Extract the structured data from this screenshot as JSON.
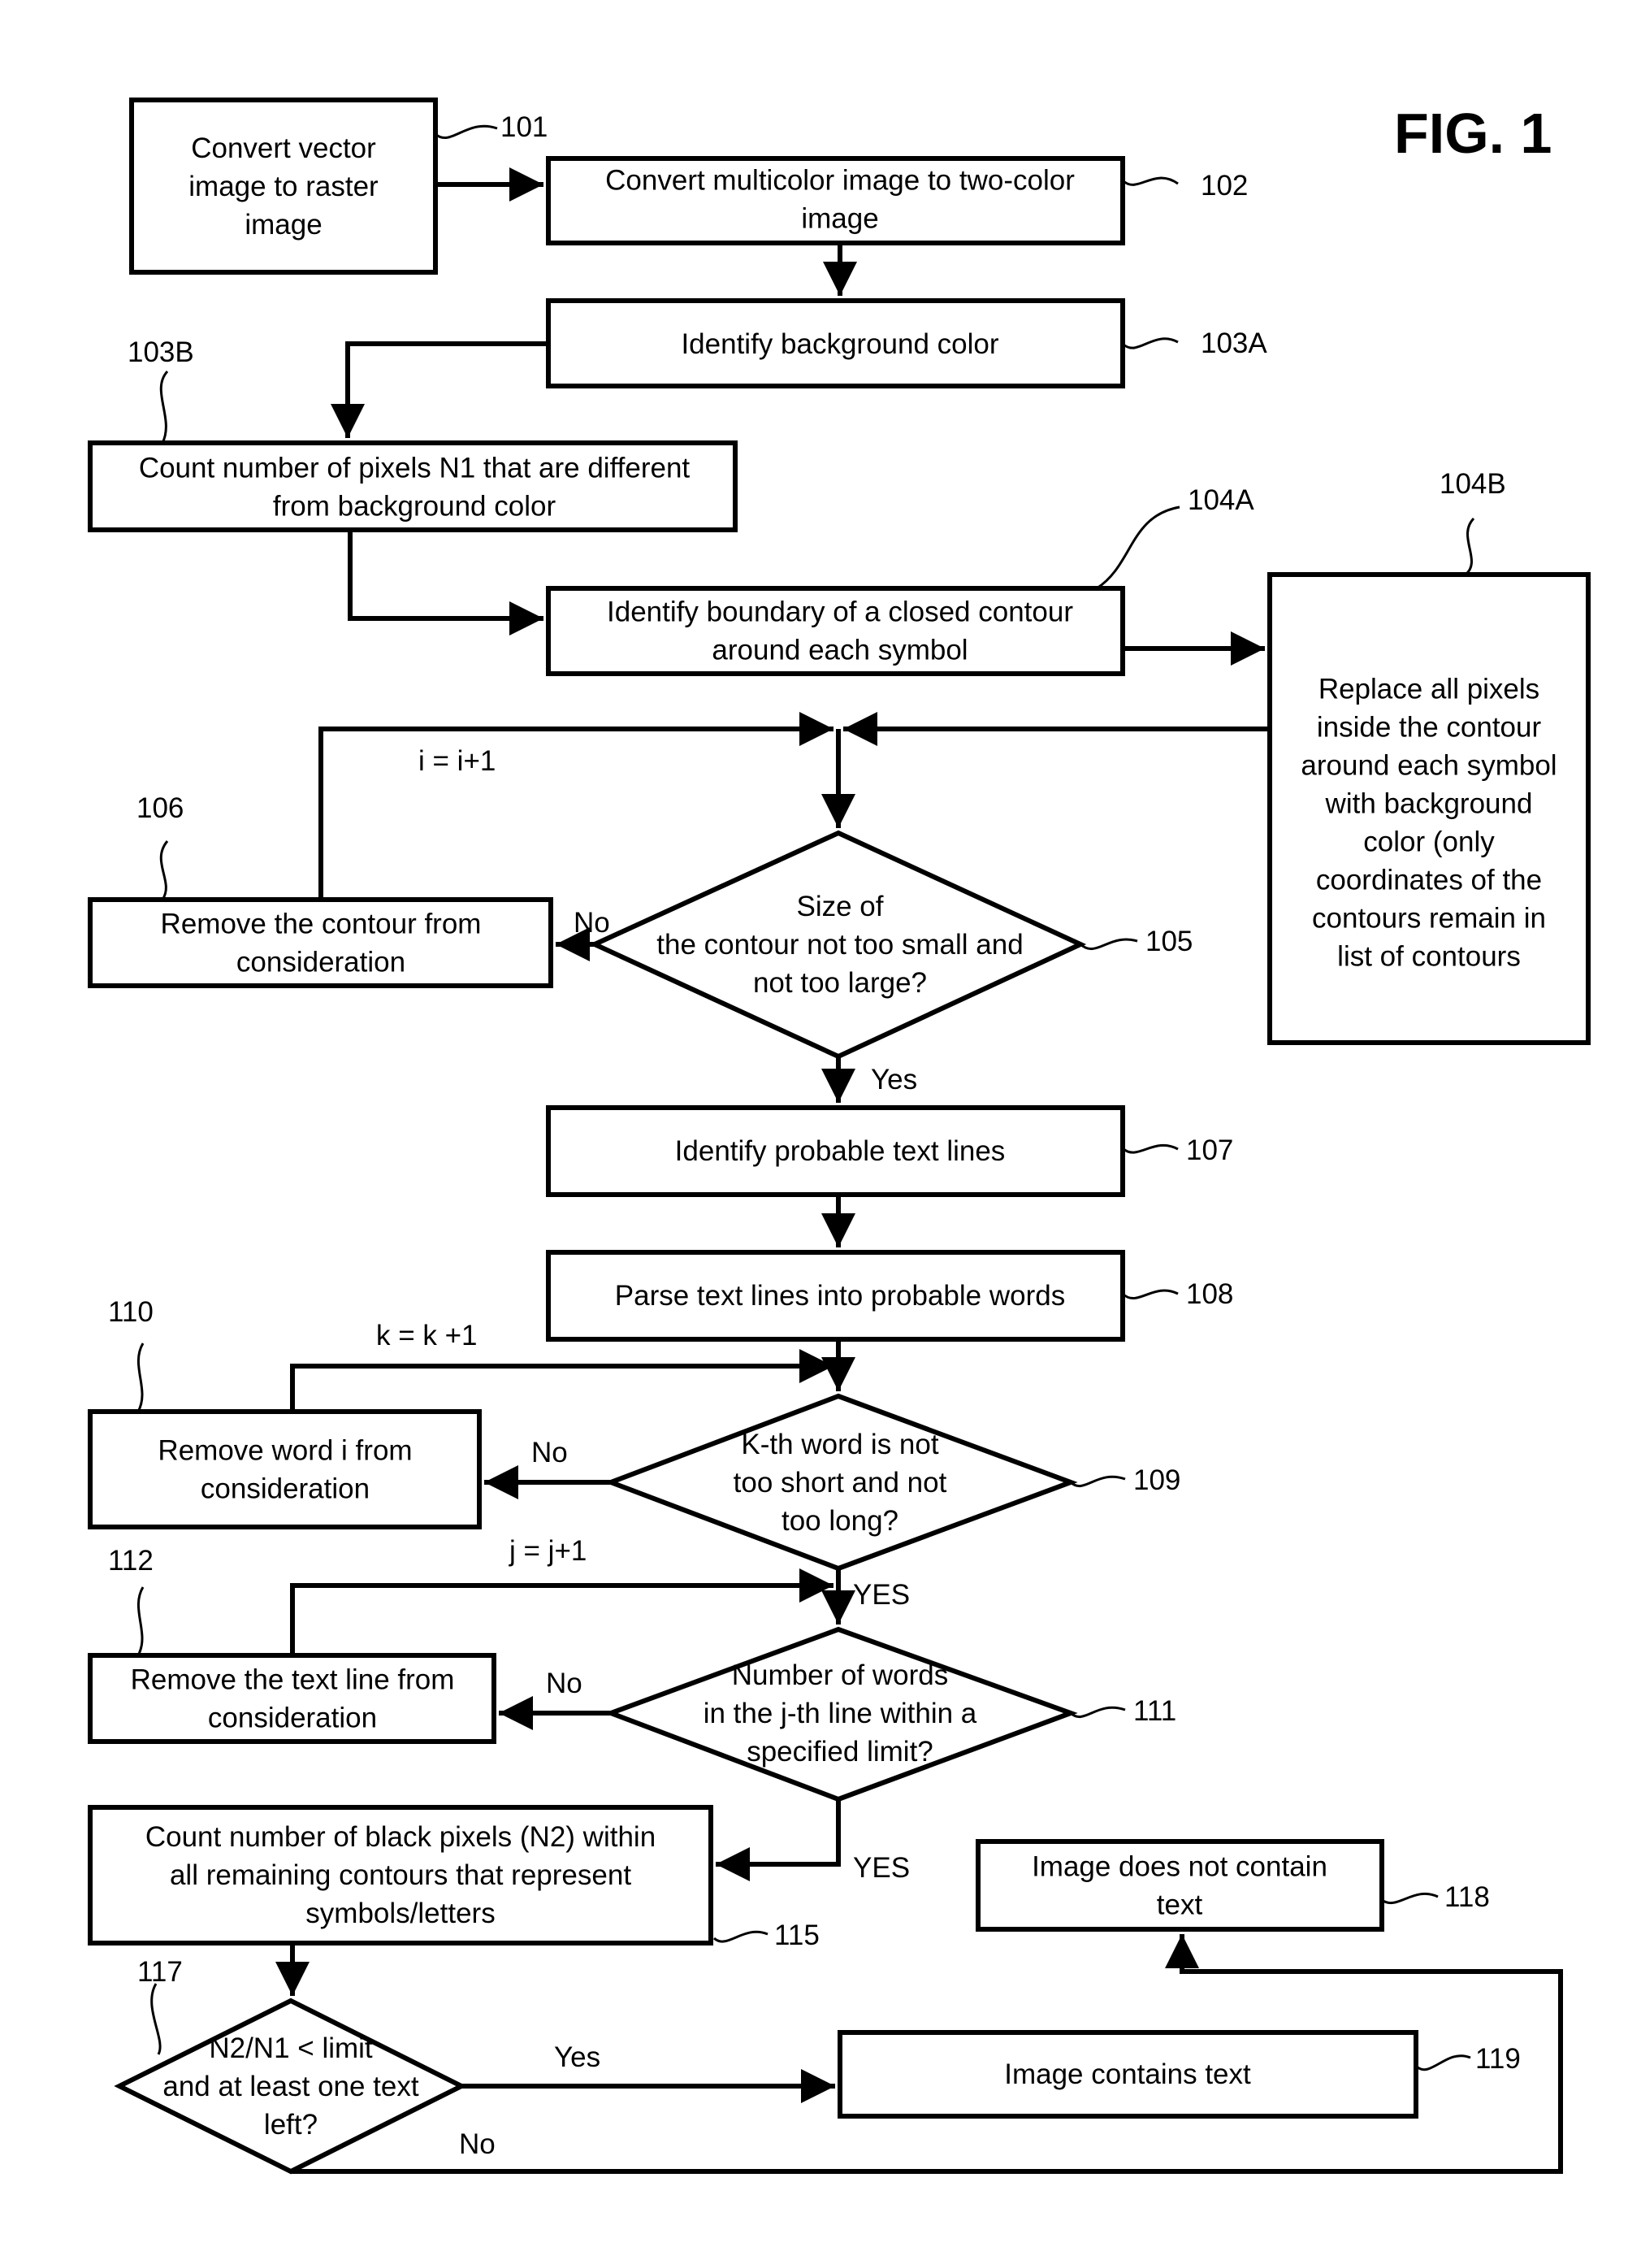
{
  "figure": {
    "title": "FIG. 1"
  },
  "colors": {
    "ink": "#000000",
    "background": "#ffffff"
  },
  "nodes": {
    "n101": {
      "ref": "101",
      "lines": [
        "Convert vector",
        "image to raster",
        "image"
      ]
    },
    "n102": {
      "ref": "102",
      "lines": [
        "Convert multicolor image to two-color",
        "image"
      ]
    },
    "n103A": {
      "ref": "103A",
      "lines": [
        "Identify background color"
      ]
    },
    "n103B": {
      "ref": "103B",
      "lines": [
        "Count number of pixels N1 that are different",
        "from background color"
      ]
    },
    "n104A": {
      "ref": "104A",
      "lines": [
        "Identify boundary of a closed contour",
        "around each symbol"
      ]
    },
    "n104B": {
      "ref": "104B",
      "lines": [
        "Replace all pixels",
        "inside the contour",
        "around each symbol",
        "with background",
        "color (only",
        "coordinates of the",
        "contours remain in",
        "list of contours"
      ]
    },
    "n105": {
      "ref": "105",
      "lines": [
        "Size of",
        "the contour not too small and",
        "not too large?"
      ]
    },
    "n106": {
      "ref": "106",
      "lines": [
        "Remove the contour from",
        "consideration"
      ]
    },
    "n107": {
      "ref": "107",
      "lines": [
        "Identify probable text lines"
      ]
    },
    "n108": {
      "ref": "108",
      "lines": [
        "Parse text lines into probable words"
      ]
    },
    "n109": {
      "ref": "109",
      "lines": [
        "K-th word is not",
        "too short and not",
        "too long?"
      ]
    },
    "n110": {
      "ref": "110",
      "lines": [
        "Remove word i from",
        "consideration"
      ]
    },
    "n111": {
      "ref": "111",
      "lines": [
        "Number of words",
        "in the j-th line within a",
        "specified limit?"
      ]
    },
    "n112": {
      "ref": "112",
      "lines": [
        "Remove the text line from",
        "consideration"
      ]
    },
    "n115": {
      "ref": "115",
      "lines": [
        "Count number of black pixels (N2) within",
        "all remaining contours that represent",
        "symbols/letters"
      ]
    },
    "n117": {
      "ref": "117",
      "lines": [
        "N2/N1 < limit",
        "and at least one text",
        "left?"
      ]
    },
    "n118": {
      "ref": "118",
      "lines": [
        "Image does not contain",
        "text"
      ]
    },
    "n119": {
      "ref": "119",
      "lines": [
        "Image contains text"
      ]
    }
  },
  "edge_labels": {
    "loop_i": "i = i+1",
    "loop_k": "k = k +1",
    "loop_j": "j = j+1",
    "e105_no": "No",
    "e105_yes": "Yes",
    "e109_no": "No",
    "e109_yes": "YES",
    "e111_no": "No",
    "e111_yes": "YES",
    "e117_yes": "Yes",
    "e117_no": "No"
  }
}
